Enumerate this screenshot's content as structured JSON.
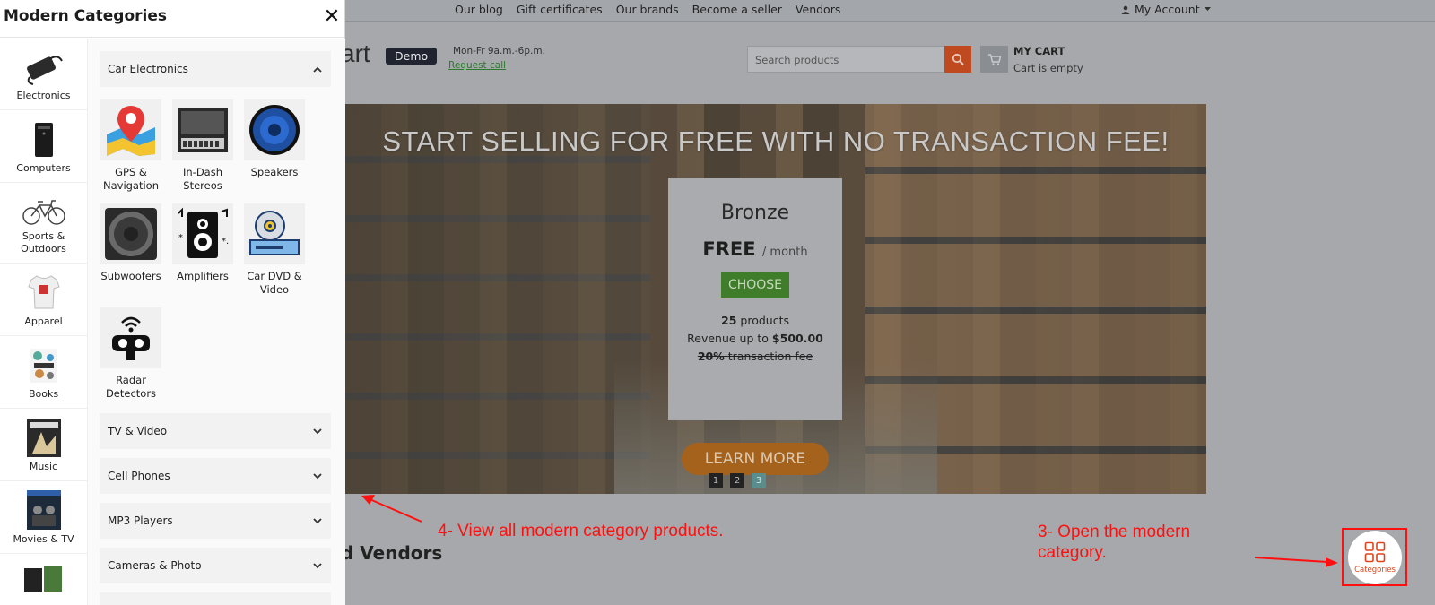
{
  "topbar": {
    "links": [
      "Our blog",
      "Gift certificates",
      "Our brands",
      "Become a seller",
      "Vendors"
    ],
    "account": "My Account"
  },
  "header": {
    "logo_text": "art",
    "demo_badge": "Demo",
    "hours": "Mon-Fr 9a.m.-6p.m.",
    "request_call": "Request call",
    "search_placeholder": "Search products",
    "cart_title": "MY CART",
    "cart_status": "Cart is empty"
  },
  "hero": {
    "title": "START SELLING FOR FREE WITH NO TRANSACTION FEE!",
    "plan_name": "Bronze",
    "plan_price": "FREE",
    "plan_period": "/ month",
    "choose_label": "CHOOSE",
    "products_count": "25",
    "products_label": "products",
    "revenue_label": "Revenue up to",
    "revenue_value": "$500.00",
    "fee_value": "20%",
    "fee_label": "transaction fee",
    "learn_more": "LEARN MORE",
    "pages": [
      "1",
      "2",
      "3"
    ],
    "active_page": "3"
  },
  "vendors_title": "d Vendors",
  "annotations": {
    "step4": "4-  View all modern category products.",
    "step3": "3-  Open the modern category."
  },
  "categories_button_label": "Categories",
  "panel": {
    "title": "Modern Categories",
    "close": "✕",
    "rail": [
      {
        "label": "Electronics",
        "icon": "charger-icon"
      },
      {
        "label": "Computers",
        "icon": "desktop-tower-icon"
      },
      {
        "label": "Sports & Outdoors",
        "icon": "bicycle-icon"
      },
      {
        "label": "Apparel",
        "icon": "tshirt-icon"
      },
      {
        "label": "Books",
        "icon": "book-collage-icon"
      },
      {
        "label": "Music",
        "icon": "album-cover-icon"
      },
      {
        "label": "Movies & TV",
        "icon": "movie-cover-icon"
      },
      {
        "label": "",
        "icon": "game-console-icon"
      }
    ],
    "expanded_section": "Car Electronics",
    "subcategories": [
      {
        "label": "GPS & Navigation",
        "icon": "map-pin-icon"
      },
      {
        "label": "In-Dash Stereos",
        "icon": "stereo-icon"
      },
      {
        "label": "Speakers",
        "icon": "speaker-icon"
      },
      {
        "label": "Subwoofers",
        "icon": "subwoofer-icon"
      },
      {
        "label": "Amplifiers",
        "icon": "amplifier-icon"
      },
      {
        "label": "Car DVD & Video",
        "icon": "dvd-player-icon"
      },
      {
        "label": "Radar Detectors",
        "icon": "radar-icon"
      }
    ],
    "collapsed_sections": [
      "TV & Video",
      "Cell Phones",
      "MP3 Players",
      "Cameras & Photo"
    ]
  }
}
